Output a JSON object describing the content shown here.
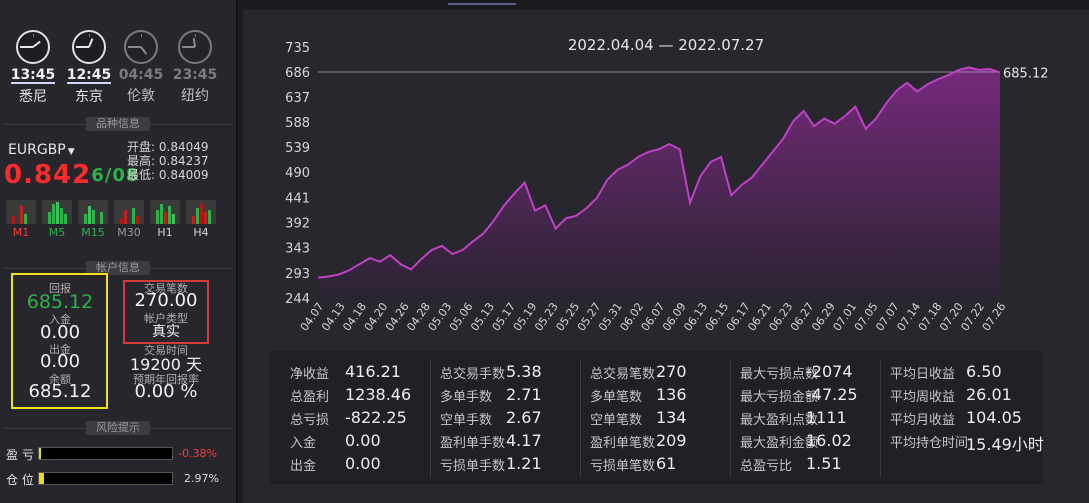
{
  "clocks": [
    {
      "time": "13:45",
      "city": "悉尼",
      "active": true,
      "hour": 13,
      "minute": 45
    },
    {
      "time": "12:45",
      "city": "东京",
      "active": true,
      "hour": 12,
      "minute": 45
    },
    {
      "time": "04:45",
      "city": "伦敦",
      "active": false,
      "hour": 4,
      "minute": 45
    },
    {
      "time": "23:45",
      "city": "纽约",
      "active": false,
      "hour": 23,
      "minute": 45
    }
  ],
  "sections": {
    "symbol_info": "品种信息",
    "account_info": "帐户信息",
    "risk": "风险提示"
  },
  "symbol": {
    "name": "EURGBP",
    "price_main": "0.842",
    "price_tail": "6/08",
    "open_label": "开盘:",
    "open": "0.84049",
    "high_label": "最高:",
    "high": "0.84237",
    "low_label": "最低:",
    "low": "0.84009",
    "timeframes": [
      "M1",
      "M5",
      "M15",
      "M30",
      "H1",
      "H4"
    ]
  },
  "account": {
    "return_label": "回报",
    "return_value": "685.12",
    "deposit_label": "入金",
    "deposit_value": "0.00",
    "withdraw_label": "出金",
    "withdraw_value": "0.00",
    "balance_label": "余额",
    "balance_value": "685.12",
    "trades_label": "交易笔数",
    "trades_value": "270.00",
    "type_label": "帐户类型",
    "type_value": "真实",
    "time_label": "交易时间",
    "time_value": "19200 天",
    "annual_label": "预期年回报率",
    "annual_value": "0.00 %"
  },
  "risk": {
    "pl_label": "盈 亏",
    "pl_value": "-0.38%",
    "pl_fill": 0.0038,
    "pos_label": "仓 位",
    "pos_value": "2.97%",
    "pos_fill": 0.0297
  },
  "colors": {
    "accent": "#b23ab8",
    "green": "#2ab34a",
    "red": "#ff2a2a",
    "yellow": "#f0e11a"
  },
  "chart_data": {
    "type": "area",
    "title": "2022.04.04 — 2022.07.27",
    "y_ticks": [
      735,
      686,
      637,
      588,
      539,
      490,
      441,
      392,
      343,
      293,
      244
    ],
    "ylim": [
      244,
      735
    ],
    "x_ticks": [
      "04.07",
      "04.13",
      "04.18",
      "04.20",
      "04.26",
      "04.28",
      "05.03",
      "05.06",
      "05.13",
      "05.17",
      "05.19",
      "05.23",
      "05.25",
      "05.27",
      "05.31",
      "06.02",
      "06.07",
      "06.09",
      "06.13",
      "06.15",
      "06.17",
      "06.21",
      "06.23",
      "06.27",
      "06.29",
      "07.01",
      "07.05",
      "07.07",
      "07.14",
      "07.18",
      "07.20",
      "07.22",
      "07.26"
    ],
    "last_value_label": "685.12",
    "reference_line": 686,
    "values": [
      284,
      286,
      290,
      298,
      310,
      322,
      315,
      328,
      310,
      300,
      320,
      338,
      346,
      330,
      338,
      355,
      370,
      395,
      425,
      448,
      470,
      415,
      425,
      380,
      400,
      405,
      420,
      440,
      475,
      495,
      505,
      520,
      530,
      535,
      545,
      535,
      430,
      482,
      510,
      520,
      445,
      465,
      480,
      505,
      530,
      555,
      590,
      610,
      580,
      595,
      585,
      600,
      618,
      575,
      595,
      625,
      650,
      665,
      648,
      662,
      672,
      680,
      690,
      695,
      690,
      692,
      685
    ]
  },
  "stats": [
    [
      {
        "k": "净收益",
        "v": "416.21"
      },
      {
        "k": "总盈利",
        "v": "1238.46"
      },
      {
        "k": "总亏损",
        "v": "-822.25"
      },
      {
        "k": "入金",
        "v": "0.00"
      },
      {
        "k": "出金",
        "v": "0.00"
      }
    ],
    [
      {
        "k": "总交易手数",
        "v": "5.38"
      },
      {
        "k": "多单手数",
        "v": "2.71"
      },
      {
        "k": "空单手数",
        "v": "2.67"
      },
      {
        "k": "盈利单手数",
        "v": "4.17"
      },
      {
        "k": "亏损单手数",
        "v": "1.21"
      }
    ],
    [
      {
        "k": "总交易笔数",
        "v": "270"
      },
      {
        "k": "多单笔数",
        "v": "136"
      },
      {
        "k": "空单笔数",
        "v": "134"
      },
      {
        "k": "盈利单笔数",
        "v": "209"
      },
      {
        "k": "亏损单笔数",
        "v": "61"
      }
    ],
    [
      {
        "k": "最大亏损点数",
        "v": "-2074"
      },
      {
        "k": "最大亏损金额",
        "v": "-47.25"
      },
      {
        "k": "最大盈利点数",
        "v": "1111"
      },
      {
        "k": "最大盈利金额",
        "v": "16.02"
      },
      {
        "k": "总盈亏比",
        "v": "1.51"
      }
    ],
    [
      {
        "k": "平均日收益",
        "v": "6.50"
      },
      {
        "k": "平均周收益",
        "v": "26.01"
      },
      {
        "k": "平均月收益",
        "v": "104.05"
      },
      {
        "k": "平均持仓时间",
        "v": "15.49小时"
      }
    ]
  ]
}
